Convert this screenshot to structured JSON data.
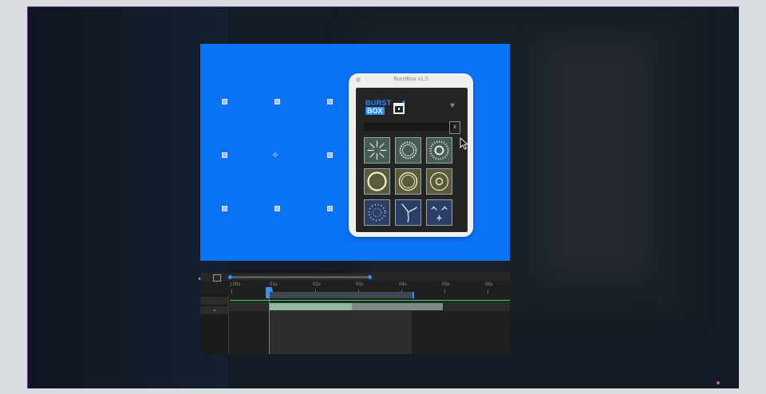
{
  "plugin": {
    "window_title": "BurstBox v1.0",
    "logo_line1": "BURST",
    "logo_line2": "BOX",
    "search_placeholder": "",
    "close_label": "x",
    "heart_icon": "heart-icon",
    "presets": [
      {
        "name": "burst-lines",
        "row": 1
      },
      {
        "name": "ring-dotted",
        "row": 1
      },
      {
        "name": "spiral-burst",
        "row": 1
      },
      {
        "name": "solid-ring",
        "row": 2
      },
      {
        "name": "double-ring",
        "row": 2
      },
      {
        "name": "small-ring",
        "row": 2
      },
      {
        "name": "radial-dashes",
        "row": 3
      },
      {
        "name": "swirl-tri",
        "row": 3
      },
      {
        "name": "spark-tri",
        "row": 3
      }
    ]
  },
  "timeline": {
    "ticks": [
      "):00s",
      "01s",
      "02s",
      "03s",
      "04s",
      "05s",
      "06s"
    ]
  },
  "colors": {
    "canvas": "#0a73f5",
    "accent": "#3d8df5",
    "green": "#3adc5a"
  }
}
